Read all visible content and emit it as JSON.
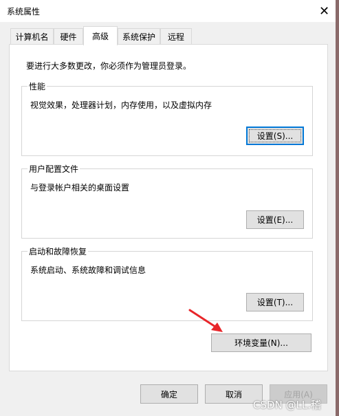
{
  "window": {
    "title": "系统属性"
  },
  "tabs": [
    {
      "label": "计算机名"
    },
    {
      "label": "硬件"
    },
    {
      "label": "高级"
    },
    {
      "label": "系统保护"
    },
    {
      "label": "远程"
    }
  ],
  "advanced": {
    "notice": "要进行大多数更改，你必须作为管理员登录。",
    "performance": {
      "title": "性能",
      "desc": "视觉效果，处理器计划，内存使用，以及虚拟内存",
      "button": "设置(S)..."
    },
    "user_profiles": {
      "title": "用户配置文件",
      "desc": "与登录帐户相关的桌面设置",
      "button": "设置(E)..."
    },
    "startup_recovery": {
      "title": "启动和故障恢复",
      "desc": "系统启动、系统故障和调试信息",
      "button": "设置(T)..."
    },
    "env_vars_button": "环境变量(N)..."
  },
  "footer": {
    "ok": "确定",
    "cancel": "取消",
    "apply": "应用(A)"
  },
  "watermark": "CSDN @LL.稽",
  "colors": {
    "accent": "#0078d7",
    "arrow": "#e8262a"
  }
}
